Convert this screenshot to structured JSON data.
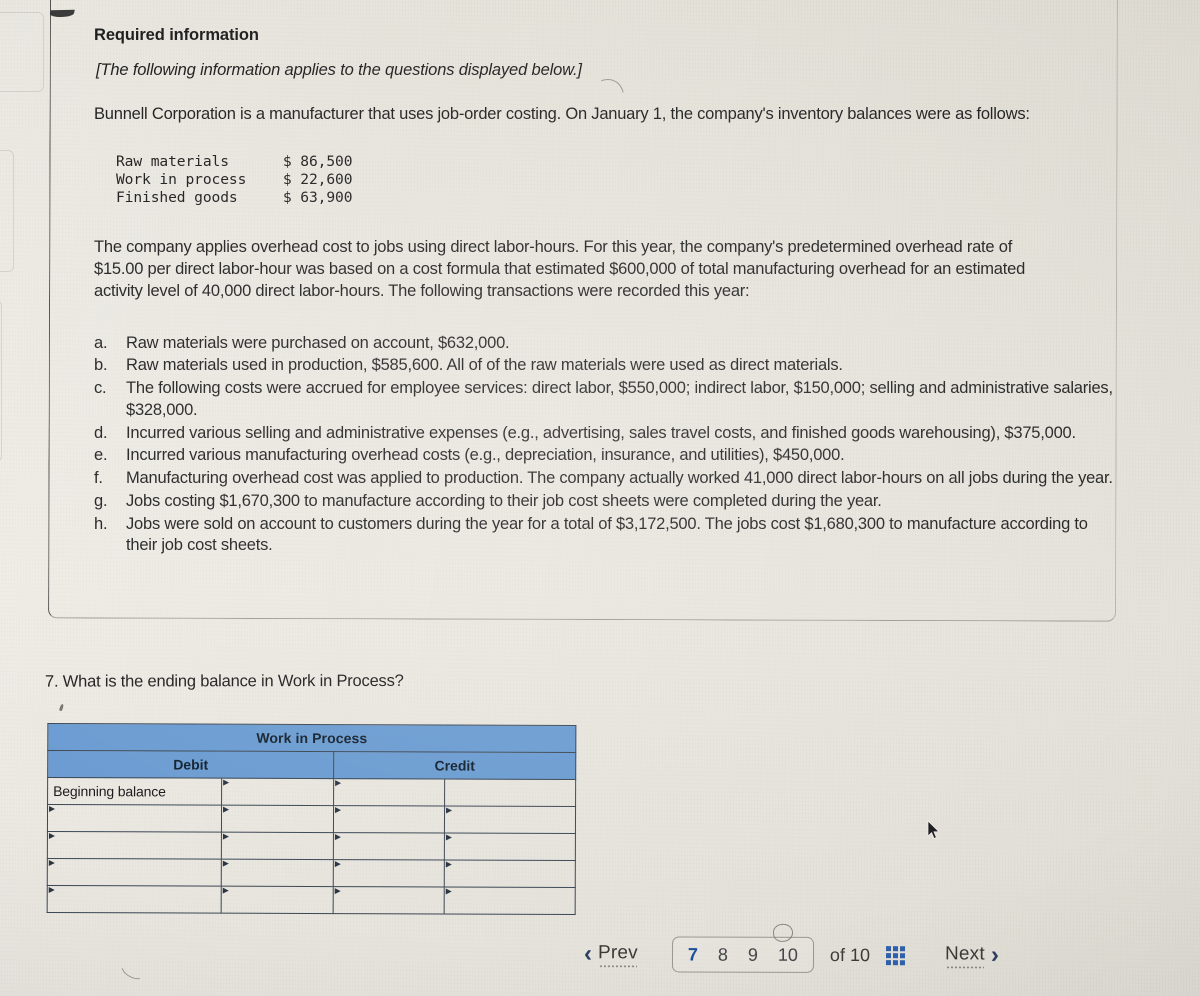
{
  "card": {
    "heading": "Required information",
    "applies_note": "[The following information applies to the questions displayed below.]",
    "intro": "Bunnell Corporation is a manufacturer that uses job-order costing. On January 1, the company's inventory balances were as follows:",
    "balances": [
      {
        "label": "Raw materials",
        "amount": "$ 86,500"
      },
      {
        "label": "Work in process",
        "amount": "$ 22,600"
      },
      {
        "label": "Finished goods",
        "amount": "$ 63,900"
      }
    ],
    "overhead_paragraph": "The company applies overhead cost to jobs using direct labor-hours. For this year, the company's predetermined overhead rate of $15.00 per direct labor-hour was based on a cost formula that estimated $600,000 of total manufacturing overhead for an estimated activity level of 40,000 direct labor-hours. The following transactions were recorded this year:",
    "transactions": [
      {
        "letter": "a.",
        "text": "Raw materials were purchased on account, $632,000."
      },
      {
        "letter": "b.",
        "text": "Raw materials used in production, $585,600. All of of the raw materials were used as direct materials."
      },
      {
        "letter": "c.",
        "text": "The following costs were accrued for employee services: direct labor, $550,000; indirect labor, $150,000; selling and administrative salaries, $328,000."
      },
      {
        "letter": "d.",
        "text": "Incurred various selling and administrative expenses (e.g., advertising, sales travel costs, and finished goods warehousing), $375,000."
      },
      {
        "letter": "e.",
        "text": "Incurred various manufacturing overhead costs (e.g., depreciation, insurance, and utilities), $450,000."
      },
      {
        "letter": "f.",
        "text": "Manufacturing overhead cost was applied to production. The company actually worked 41,000 direct labor-hours on all jobs during the year."
      },
      {
        "letter": "g.",
        "text": "Jobs costing $1,670,300 to manufacture according to their job cost sheets were completed during the year."
      },
      {
        "letter": "h.",
        "text": "Jobs were sold on account to customers during the year for a total of $3,172,500. The jobs cost $1,680,300 to manufacture according to their job cost sheets."
      }
    ]
  },
  "question": {
    "number": "7.",
    "prompt": "What is the ending balance in Work in Process?"
  },
  "wip_table": {
    "title": "Work in Process",
    "column_headers": [
      "Debit",
      "Credit"
    ],
    "rows": [
      {
        "debit_label": "Beginning balance",
        "debit_amount": "",
        "credit_label": "",
        "credit_amount": ""
      },
      {
        "debit_label": "",
        "debit_amount": "",
        "credit_label": "",
        "credit_amount": ""
      },
      {
        "debit_label": "",
        "debit_amount": "",
        "credit_label": "",
        "credit_amount": ""
      },
      {
        "debit_label": "",
        "debit_amount": "",
        "credit_label": "",
        "credit_amount": ""
      },
      {
        "debit_label": "",
        "debit_amount": "",
        "credit_label": "",
        "credit_amount": ""
      }
    ],
    "header_color": "#6a9bd1",
    "border_color": "#3b4754"
  },
  "pager": {
    "prev_label": "Prev",
    "next_label": "Next",
    "prev_chevron": "‹",
    "next_chevron": "›",
    "page_numbers": [
      "7",
      "8",
      "9",
      "10"
    ],
    "active_page": "7",
    "of_label": "of 10",
    "total_pages": "10",
    "grid_icon": "grid-3x3-icon",
    "active_color": "#1b4f9c"
  }
}
